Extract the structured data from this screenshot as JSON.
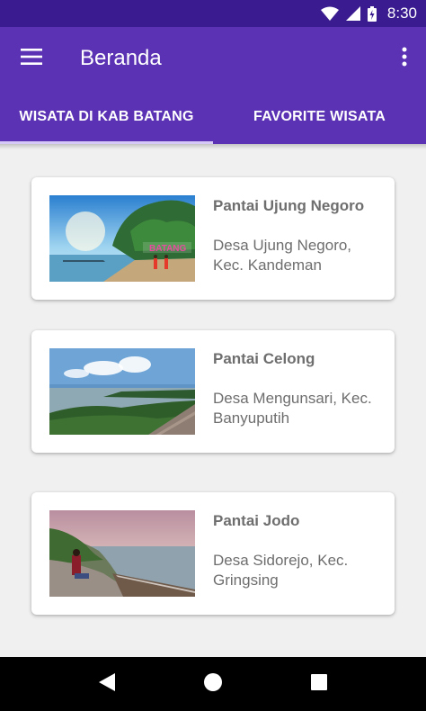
{
  "status_bar": {
    "time": "8:30"
  },
  "app_bar": {
    "title": "Beranda"
  },
  "tabs": [
    {
      "label": "WISATA DI KAB BATANG",
      "active": true
    },
    {
      "label": "FAVORITE WISATA",
      "active": false
    }
  ],
  "destinations": [
    {
      "name": "Pantai Ujung Negoro",
      "location": "Desa Ujung Negoro, Kec. Kandeman",
      "sign_text": "BATANG"
    },
    {
      "name": "Pantai Celong",
      "location": "Desa Mengunsari, Kec. Banyuputih"
    },
    {
      "name": "Pantai Jodo",
      "location": "Desa Sidorejo, Kec. Gringsing"
    }
  ],
  "colors": {
    "primary": "#5a32b3",
    "primary_dark": "#3a1c90",
    "tab_indicator": "#d6c9f7",
    "text_secondary": "#6e6e6e"
  },
  "icons": {
    "menu": "hamburger-icon",
    "overflow": "more-vert-icon",
    "back": "back-triangle-icon",
    "home": "home-circle-icon",
    "recents": "recents-square-icon"
  }
}
